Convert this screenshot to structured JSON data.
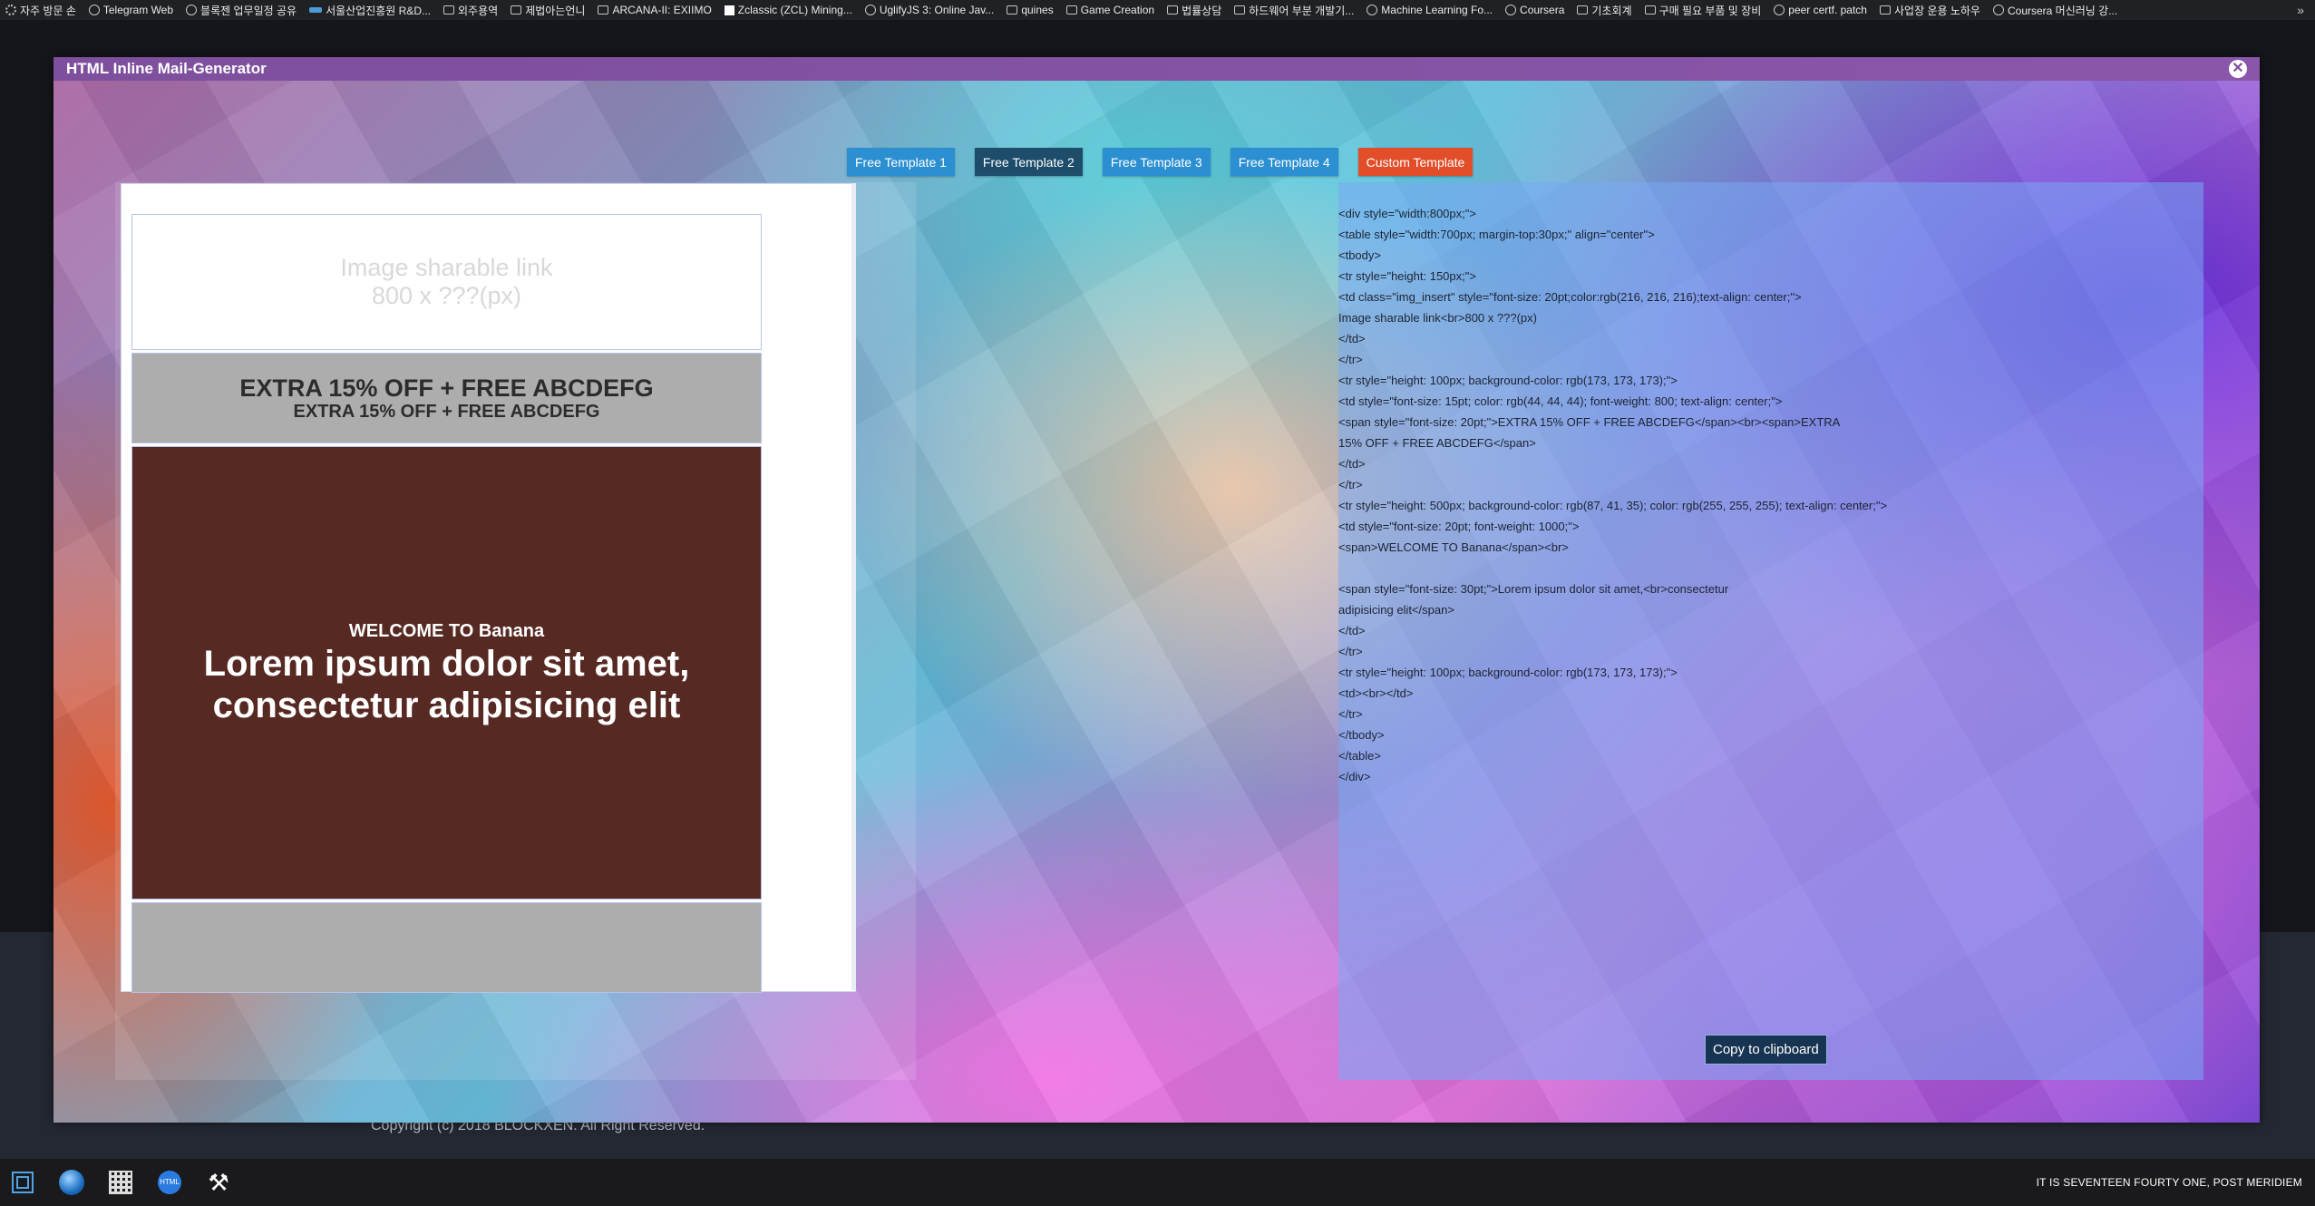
{
  "bookmarks": [
    {
      "label": "자주 방문 손",
      "icon": "gear-icon"
    },
    {
      "label": "Telegram Web",
      "icon": "globe-icon"
    },
    {
      "label": "블록젠 업무일정 공유",
      "icon": "globe-icon"
    },
    {
      "label": "서울산업진흥원 R&D...",
      "icon": "sba-logo-icon"
    },
    {
      "label": "외주용역",
      "icon": "folder-icon"
    },
    {
      "label": "제법아는언니",
      "icon": "app-icon"
    },
    {
      "label": "ARCANA-II: EXIIMO",
      "icon": "folder-icon"
    },
    {
      "label": "Zclassic (ZCL) Mining...",
      "icon": "square-icon"
    },
    {
      "label": "UglifyJS 3: Online Jav...",
      "icon": "globe-icon"
    },
    {
      "label": "quines",
      "icon": "folder-icon"
    },
    {
      "label": "Game Creation",
      "icon": "folder-icon"
    },
    {
      "label": "법률상담",
      "icon": "folder-icon"
    },
    {
      "label": "하드웨어 부분 개발기...",
      "icon": "folder-icon"
    },
    {
      "label": "Machine Learning Fo...",
      "icon": "globe-icon"
    },
    {
      "label": "Coursera",
      "icon": "globe-icon"
    },
    {
      "label": "기초회계",
      "icon": "folder-icon"
    },
    {
      "label": "구매 필요 부품 및 장비",
      "icon": "folder-icon"
    },
    {
      "label": "peer certf. patch",
      "icon": "globe-icon"
    },
    {
      "label": "사업장 운용 노하우",
      "icon": "folder-icon"
    },
    {
      "label": "Coursera 머신러닝 강...",
      "icon": "globe-icon"
    }
  ],
  "bookmarks_more": "»",
  "modal": {
    "title": "HTML Inline Mail-Generator",
    "close": "✕"
  },
  "tabs": [
    {
      "label": "Free Template 1",
      "state": "normal"
    },
    {
      "label": "Free Template 2",
      "state": "active"
    },
    {
      "label": "Free Template 3",
      "state": "normal"
    },
    {
      "label": "Free Template 4",
      "state": "normal"
    },
    {
      "label": "Custom Template",
      "state": "custom"
    }
  ],
  "preview": {
    "image_line1": "Image sharable link",
    "image_line2": "800 x ???(px)",
    "promo_big": "EXTRA 15% OFF + FREE ABCDEFG",
    "promo_small": "EXTRA 15% OFF + FREE ABCDEFG",
    "welcome_small": "WELCOME TO Banana",
    "welcome_big": "Lorem ipsum dolor sit amet, consectetur adipisicing elit"
  },
  "code": {
    "text": "<div style=\"width:800px;\">\n<table style=\"width:700px; margin-top:30px;\" align=\"center\">\n<tbody>\n<tr style=\"height: 150px;\">\n<td class=\"img_insert\" style=\"font-size: 20pt;color:rgb(216, 216, 216);text-align: center;\">\nImage sharable link<br>800 x ???(px)\n</td>\n</tr>\n<tr style=\"height: 100px; background-color: rgb(173, 173, 173);\">\n<td style=\"font-size: 15pt; color: rgb(44, 44, 44); font-weight: 800; text-align: center;\">\n<span style=\"font-size: 20pt;\">EXTRA 15% OFF + FREE ABCDEFG</span><br><span>EXTRA\n15% OFF + FREE ABCDEFG</span>\n</td>\n</tr>\n<tr style=\"height: 500px; background-color: rgb(87, 41, 35); color: rgb(255, 255, 255); text-align: center;\">\n<td style=\"font-size: 20pt; font-weight: 1000;\">\n<span>WELCOME TO Banana</span><br>\n\n<span style=\"font-size: 30pt;\">Lorem ipsum dolor sit amet,<br>consectetur\nadipisicing elit</span>\n</td>\n</tr>\n<tr style=\"height: 100px; background-color: rgb(173, 173, 173);\">\n<td><br></td>\n</tr>\n</tbody>\n</table>\n</div>",
    "copy_button": "Copy to clipboard"
  },
  "footer": {
    "copyright": "Copyright (c) 2018 BLOCKXEN. All Right Reserved."
  },
  "taskbar": {
    "note_icon_label": "HTML",
    "status": "IT IS SEVENTEEN FOURTY ONE, POST MERIDIEM"
  },
  "colors": {
    "modal_header": "#7d4f9c",
    "tab_normal": "#2b8fd1",
    "tab_active": "#1d4d6b",
    "tab_custom": "#e24e2a",
    "promo_bg": "#adadad",
    "welcome_bg": "#572923",
    "copy_button_bg": "#173552"
  }
}
